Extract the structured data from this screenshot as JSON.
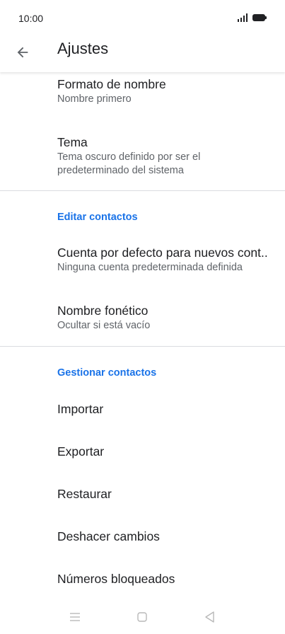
{
  "status_bar": {
    "time": "10:00"
  },
  "app_bar": {
    "title": "Ajustes"
  },
  "settings": {
    "name_format": {
      "title": "Formato de nombre",
      "value": "Nombre primero"
    },
    "theme": {
      "title": "Tema",
      "value_line1": "Tema oscuro definido por ser el",
      "value_line2": "predeterminado del sistema"
    },
    "edit_contacts_header": "Editar contactos",
    "default_account": {
      "title": "Cuenta por defecto para nuevos cont..",
      "value": "Ninguna cuenta predeterminada definida"
    },
    "phonetic_name": {
      "title": "Nombre fonético",
      "value": "Ocultar si está vacío"
    },
    "manage_contacts_header": "Gestionar contactos",
    "import": {
      "title": "Importar"
    },
    "export": {
      "title": "Exportar"
    },
    "restore": {
      "title": "Restaurar"
    },
    "undo_changes": {
      "title": "Deshacer cambios"
    },
    "blocked_numbers": {
      "title": "Números bloqueados"
    }
  },
  "colors": {
    "accent": "#1a73e8",
    "text": "#202124",
    "secondary_text": "#5f6368",
    "divider": "#dadce0"
  },
  "icons": {
    "back": "arrow-left-icon",
    "signal": "signal-icon",
    "battery": "battery-icon",
    "recents": "menu-icon",
    "home": "home-square-icon",
    "back_nav": "back-triangle-icon"
  }
}
